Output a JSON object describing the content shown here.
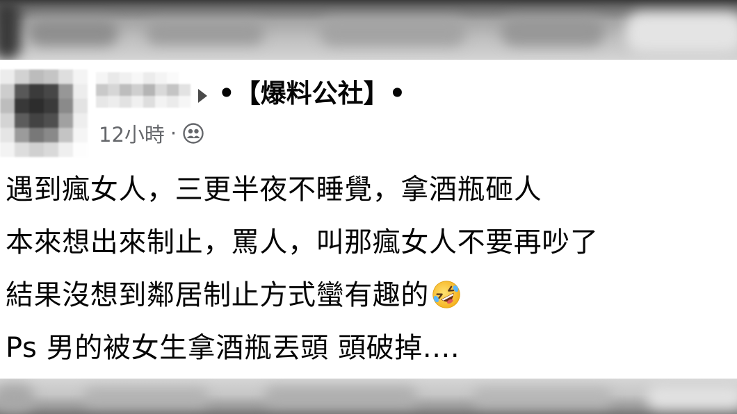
{
  "post": {
    "separator_icon": "triangle-right-icon",
    "group_name": "•【爆料公社】•",
    "timestamp": "12小時",
    "meta_separator": "·",
    "audience_icon": "group-icon",
    "lines": [
      "遇到瘋女人，三更半夜不睡覺，拿酒瓶砸人",
      "本來想出來制止，罵人，叫那瘋女人不要再吵了",
      "結果沒想到鄰居制止方式蠻有趣的",
      "Ps 男的被女生拿酒瓶丟頭 頭破掉...."
    ],
    "line3_emoji": "rolling-on-the-floor-laughing-icon"
  },
  "colors": {
    "text": "#050505",
    "meta_text": "#65676b",
    "background": "#ffffff"
  }
}
